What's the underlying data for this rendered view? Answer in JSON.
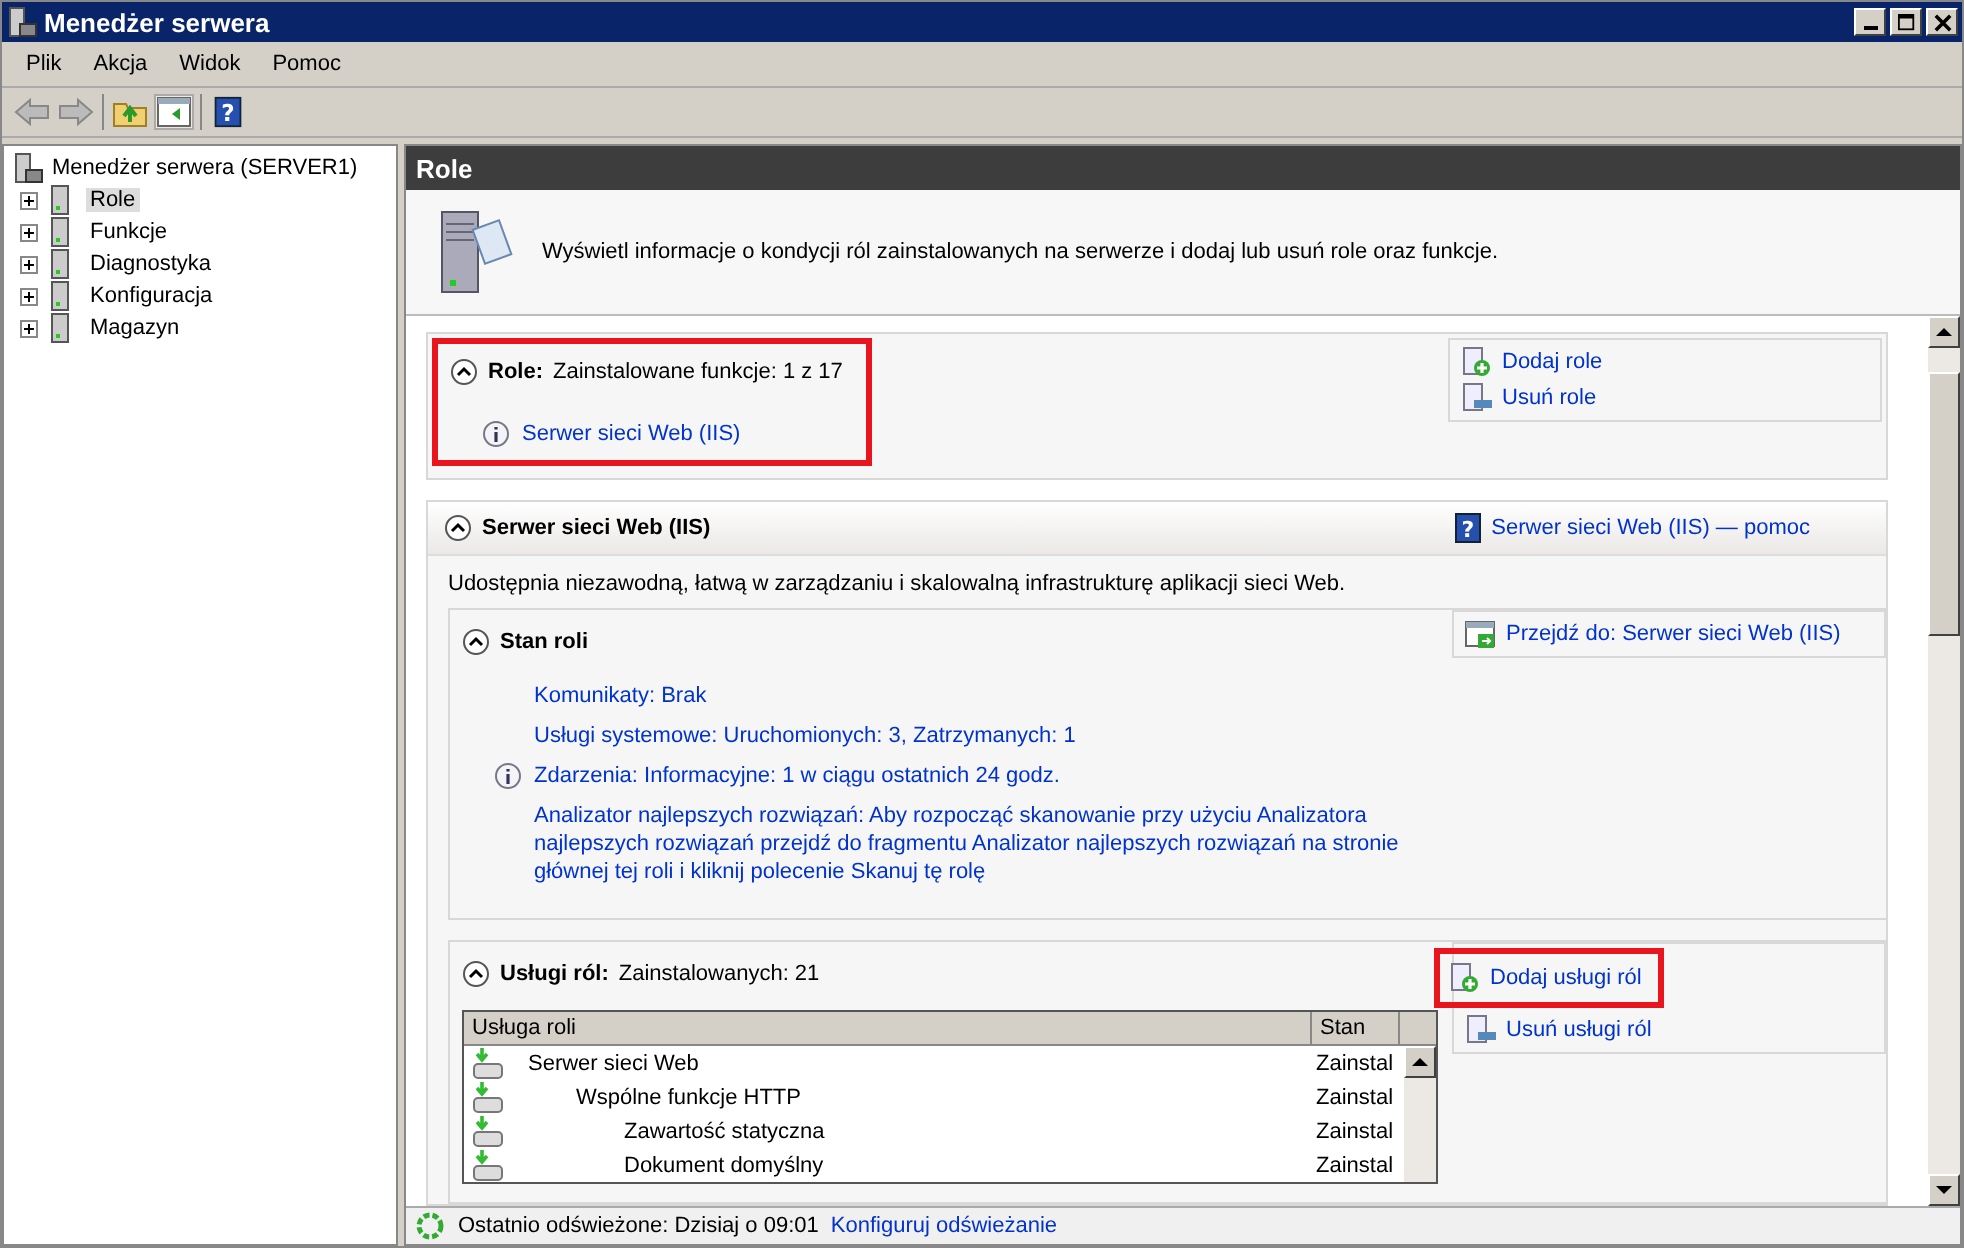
{
  "window": {
    "title": "Menedżer serwera"
  },
  "toolbar": {
    "help_glyph": "?"
  },
  "menu": [
    {
      "label": "Plik"
    },
    {
      "label": "Akcja"
    },
    {
      "label": "Widok"
    },
    {
      "label": "Pomoc"
    }
  ],
  "tree": {
    "root": "Menedżer serwera (SERVER1)",
    "items": [
      {
        "label": "Role",
        "selected": true,
        "expanded": false
      },
      {
        "label": "Funkcje",
        "selected": false,
        "expanded": false
      },
      {
        "label": "Diagnostyka",
        "selected": false,
        "expanded": false
      },
      {
        "label": "Konfiguracja",
        "selected": false,
        "expanded": false
      },
      {
        "label": "Magazyn",
        "selected": false,
        "expanded": false
      }
    ]
  },
  "pane": {
    "title": "Role",
    "description": "Wyświetl informacje o kondycji ról zainstalowanych na serwerze i dodaj lub usuń role oraz funkcje."
  },
  "roles_summary": {
    "title": "Role:",
    "summary": "Zainstalowane funkcje: 1 z 17",
    "highlighted": true,
    "expanded": true,
    "items": [
      "Serwer sieci Web (IIS)"
    ],
    "actions": [
      {
        "label": "Dodaj role",
        "kind": "add",
        "highlighted": false
      },
      {
        "label": "Usuń role",
        "kind": "remove",
        "highlighted": false
      }
    ]
  },
  "role_section": {
    "title": "Serwer sieci Web (IIS)",
    "expanded": true,
    "help_glyph": "?",
    "help_link": "Serwer sieci Web (IIS) — pomoc",
    "description": "Udostępnia niezawodną, łatwą w zarządzaniu i skalowalną infrastrukturę aplikacji sieci Web.",
    "status": {
      "title": "Stan roli",
      "expanded": true,
      "action": "Przejdź do: Serwer sieci Web (IIS)",
      "lines": [
        {
          "text": "Komunikaty: Brak",
          "info": false
        },
        {
          "text": "Usługi systemowe: Uruchomionych: 3, Zatrzymanych: 1",
          "info": false
        },
        {
          "text": "Zdarzenia: Informacyjne: 1 w ciągu ostatnich 24 godz.",
          "info": true
        },
        {
          "text": "Analizator najlepszych rozwiązań: Aby rozpocząć skanowanie przy użyciu Analizatora najlepszych rozwiązań przejdź do fragmentu Analizator najlepszych rozwiązań na stronie głównej tej roli i kliknij polecenie Skanuj tę rolę",
          "info": false
        }
      ]
    },
    "services": {
      "title": "Usługi ról:",
      "summary": "Zainstalowanych: 21",
      "expanded": true,
      "actions": [
        {
          "label": "Dodaj usługi ról",
          "kind": "add",
          "highlighted": true
        },
        {
          "label": "Usuń usługi ról",
          "kind": "remove",
          "highlighted": false
        }
      ],
      "columns": [
        "Usługa roli",
        "Stan"
      ],
      "rows": [
        {
          "name": "Serwer sieci Web",
          "status": "Zainstal",
          "children": [
            {
              "name": "Wspólne funkcje HTTP",
              "status": "Zainstal",
              "children": [
                {
                  "name": "Zawartość statyczna",
                  "status": "Zainstal"
                },
                {
                  "name": "Dokument domyślny",
                  "status": "Zainstal"
                }
              ]
            }
          ]
        }
      ]
    }
  },
  "status_bar": {
    "text": "Ostatnio odświeżone: Dzisiaj o 09:01",
    "link": "Konfiguruj odświeżanie"
  }
}
